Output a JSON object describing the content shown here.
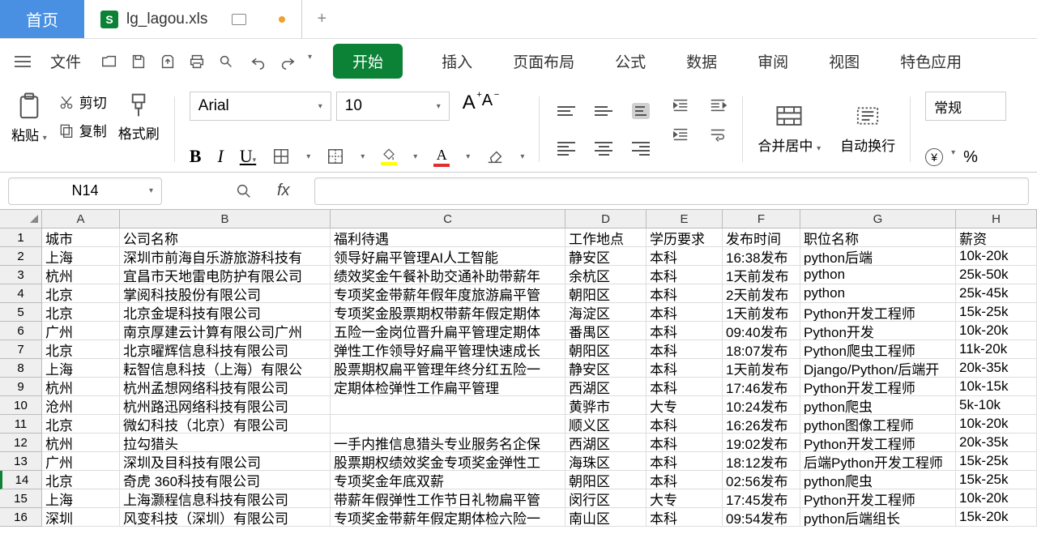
{
  "tabs": {
    "home": "首页",
    "filename": "lg_lagou.xls"
  },
  "menu": {
    "file": "文件",
    "start": "开始",
    "items": [
      "插入",
      "页面布局",
      "公式",
      "数据",
      "审阅",
      "视图",
      "特色应用"
    ]
  },
  "ribbon": {
    "paste": "粘贴",
    "cut": "剪切",
    "copy": "复制",
    "format_brush": "格式刷",
    "font_name": "Arial",
    "font_size": "10",
    "merge_center": "合并居中",
    "auto_wrap": "自动换行",
    "format_type": "常规"
  },
  "cellref": "N14",
  "columns": [
    "A",
    "B",
    "C",
    "D",
    "E",
    "F",
    "G",
    "H"
  ],
  "col_widths": [
    "cA",
    "cB",
    "cC",
    "cD",
    "cE",
    "cF",
    "cG",
    "cH"
  ],
  "rows": [
    {
      "n": "1",
      "cells": [
        "城市",
        "公司名称",
        "福利待遇",
        "工作地点",
        "学历要求",
        "发布时间",
        "职位名称",
        "薪资"
      ]
    },
    {
      "n": "2",
      "cells": [
        "上海",
        "深圳市前海自乐游旅游科技有",
        "领导好扁平管理AI人工智能",
        "静安区",
        "本科",
        "16:38发布",
        "python后端",
        "10k-20k"
      ]
    },
    {
      "n": "3",
      "cells": [
        "杭州",
        "宜昌市天地雷电防护有限公司",
        "绩效奖金午餐补助交通补助带薪年",
        "余杭区",
        "本科",
        "1天前发布",
        "python",
        "25k-50k"
      ]
    },
    {
      "n": "4",
      "cells": [
        "北京",
        "掌阅科技股份有限公司",
        "专项奖金带薪年假年度旅游扁平管",
        "朝阳区",
        "本科",
        "2天前发布",
        "python",
        "25k-45k"
      ]
    },
    {
      "n": "5",
      "cells": [
        "北京",
        "北京金堤科技有限公司",
        "专项奖金股票期权带薪年假定期体",
        "海淀区",
        "本科",
        "1天前发布",
        "Python开发工程师",
        "15k-25k"
      ]
    },
    {
      "n": "6",
      "cells": [
        "广州",
        "南京厚建云计算有限公司广州",
        "五险一金岗位晋升扁平管理定期体",
        "番禺区",
        "本科",
        "09:40发布",
        "Python开发",
        "10k-20k"
      ]
    },
    {
      "n": "7",
      "cells": [
        "北京",
        "北京曜辉信息科技有限公司",
        "弹性工作领导好扁平管理快速成长",
        "朝阳区",
        "本科",
        "18:07发布",
        "Python爬虫工程师",
        "11k-20k"
      ]
    },
    {
      "n": "8",
      "cells": [
        "上海",
        "耘智信息科技（上海）有限公",
        "股票期权扁平管理年终分红五险一",
        "静安区",
        "本科",
        "1天前发布",
        "Django/Python/后端开",
        "20k-35k"
      ]
    },
    {
      "n": "9",
      "cells": [
        "杭州",
        "杭州孟想网络科技有限公司",
        "定期体检弹性工作扁平管理",
        "西湖区",
        "本科",
        "17:46发布",
        "Python开发工程师",
        "10k-15k"
      ]
    },
    {
      "n": "10",
      "cells": [
        "沧州",
        "杭州路迅网络科技有限公司",
        "",
        "黄骅市",
        "大专",
        "10:24发布",
        "python爬虫",
        "5k-10k"
      ]
    },
    {
      "n": "11",
      "cells": [
        "北京",
        "微幻科技（北京）有限公司",
        "",
        "顺义区",
        "本科",
        "16:26发布",
        "python图像工程师",
        "10k-20k"
      ]
    },
    {
      "n": "12",
      "cells": [
        "杭州",
        "拉勾猎头",
        "一手内推信息猎头专业服务名企保",
        "西湖区",
        "本科",
        "19:02发布",
        "Python开发工程师",
        "20k-35k"
      ]
    },
    {
      "n": "13",
      "cells": [
        "广州",
        "深圳及目科技有限公司",
        "股票期权绩效奖金专项奖金弹性工",
        "海珠区",
        "本科",
        "18:12发布",
        "后端Python开发工程师",
        "15k-25k"
      ]
    },
    {
      "n": "14",
      "cells": [
        "北京",
        "奇虎 360科技有限公司",
        "专项奖金年底双薪",
        "朝阳区",
        "本科",
        "02:56发布",
        "python爬虫",
        "15k-25k"
      ],
      "active": true
    },
    {
      "n": "15",
      "cells": [
        "上海",
        "上海灏程信息科技有限公司",
        "带薪年假弹性工作节日礼物扁平管",
        "闵行区",
        "大专",
        "17:45发布",
        "Python开发工程师",
        "10k-20k"
      ]
    },
    {
      "n": "16",
      "cells": [
        "深圳",
        "风变科技（深圳）有限公司",
        "专项奖金带薪年假定期体检六险一",
        "南山区",
        "本科",
        "09:54发布",
        "python后端组长",
        "15k-20k"
      ]
    }
  ]
}
